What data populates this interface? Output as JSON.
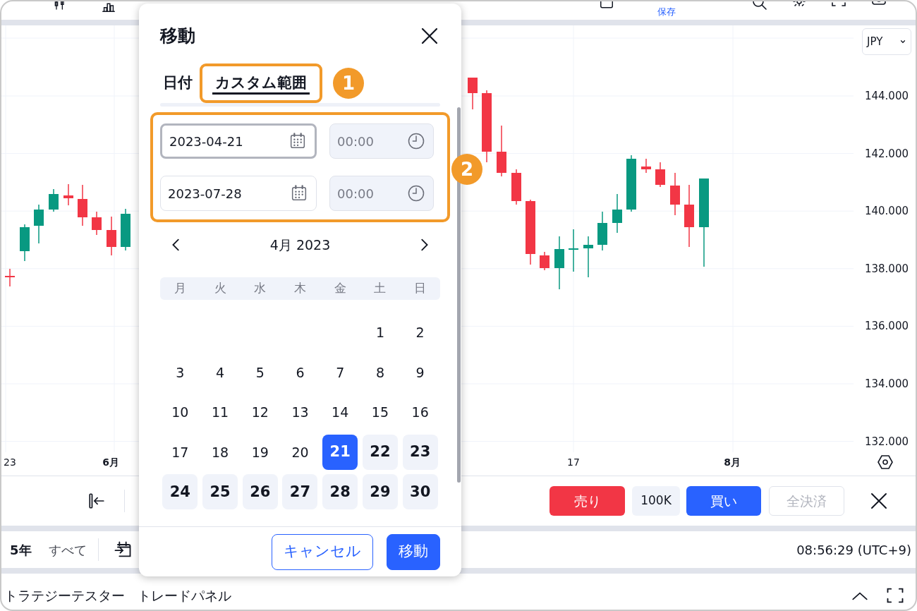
{
  "toolbar": {
    "save_label": "保存"
  },
  "chart": {
    "currency": "JPY",
    "price_labels": [
      "144.000",
      "142.000",
      "140.000",
      "138.000",
      "136.000",
      "134.000",
      "132.000"
    ],
    "time_labels": [
      {
        "text": "23",
        "kind": "day"
      },
      {
        "text": "6月",
        "kind": "month"
      },
      {
        "text": "17",
        "kind": "day"
      },
      {
        "text": "8月",
        "kind": "month"
      }
    ]
  },
  "trade_bar": {
    "sell": "売り",
    "quantity": "100K",
    "buy": "買い",
    "close_all": {
      "label": "全決済",
      "disabled": true
    }
  },
  "range_bar": {
    "items": [
      {
        "label": "5年",
        "selected": true
      },
      {
        "label": "すべて",
        "selected": false
      }
    ],
    "clock": "08:56:29 (UTC+9)"
  },
  "bottom_tabs": [
    {
      "label": "トラテジーテスター"
    },
    {
      "label": "トレードパネル"
    }
  ],
  "dialog": {
    "title": "移動",
    "tabs": [
      {
        "label": "日付",
        "selected": false
      },
      {
        "label": "カスタム範囲",
        "selected": true
      }
    ],
    "ranges": [
      {
        "date": "2023-04-21",
        "time": "00:00",
        "focused": true,
        "time_disabled": true
      },
      {
        "date": "2023-07-28",
        "time": "00:00",
        "focused": false,
        "time_disabled": true
      }
    ],
    "calendar": {
      "month": "4月 2023",
      "weekdays": [
        "月",
        "火",
        "水",
        "木",
        "金",
        "土",
        "日"
      ],
      "weeks": [
        [
          {
            "day": "1",
            "selected": false,
            "in_range": false
          },
          {
            "day": "2",
            "selected": false,
            "in_range": false
          }
        ],
        [
          {
            "day": "3",
            "selected": false,
            "in_range": false
          },
          {
            "day": "4",
            "selected": false,
            "in_range": false
          },
          {
            "day": "5",
            "selected": false,
            "in_range": false
          },
          {
            "day": "6",
            "selected": false,
            "in_range": false
          },
          {
            "day": "7",
            "selected": false,
            "in_range": false
          },
          {
            "day": "8",
            "selected": false,
            "in_range": false
          },
          {
            "day": "9",
            "selected": false,
            "in_range": false
          }
        ],
        [
          {
            "day": "10",
            "selected": false,
            "in_range": false
          },
          {
            "day": "11",
            "selected": false,
            "in_range": false
          },
          {
            "day": "12",
            "selected": false,
            "in_range": false
          },
          {
            "day": "13",
            "selected": false,
            "in_range": false
          },
          {
            "day": "14",
            "selected": false,
            "in_range": false
          },
          {
            "day": "15",
            "selected": false,
            "in_range": false
          },
          {
            "day": "16",
            "selected": false,
            "in_range": false
          }
        ],
        [
          {
            "day": "17",
            "selected": false,
            "in_range": false
          },
          {
            "day": "18",
            "selected": false,
            "in_range": false
          },
          {
            "day": "19",
            "selected": false,
            "in_range": false
          },
          {
            "day": "20",
            "selected": false,
            "in_range": false
          },
          {
            "day": "21",
            "selected": true,
            "in_range": true
          },
          {
            "day": "22",
            "selected": false,
            "in_range": true
          },
          {
            "day": "23",
            "selected": false,
            "in_range": true
          }
        ],
        [
          {
            "day": "24",
            "selected": false,
            "in_range": true
          },
          {
            "day": "25",
            "selected": false,
            "in_range": true
          },
          {
            "day": "26",
            "selected": false,
            "in_range": true
          },
          {
            "day": "27",
            "selected": false,
            "in_range": true
          },
          {
            "day": "28",
            "selected": false,
            "in_range": true
          },
          {
            "day": "29",
            "selected": false,
            "in_range": true
          },
          {
            "day": "30",
            "selected": false,
            "in_range": true
          }
        ]
      ]
    },
    "buttons": [
      {
        "label": "キャンセル",
        "kind": "secondary"
      },
      {
        "label": "移動",
        "kind": "primary"
      }
    ]
  },
  "annotations": [
    {
      "number": "1"
    },
    {
      "number": "2"
    }
  ]
}
